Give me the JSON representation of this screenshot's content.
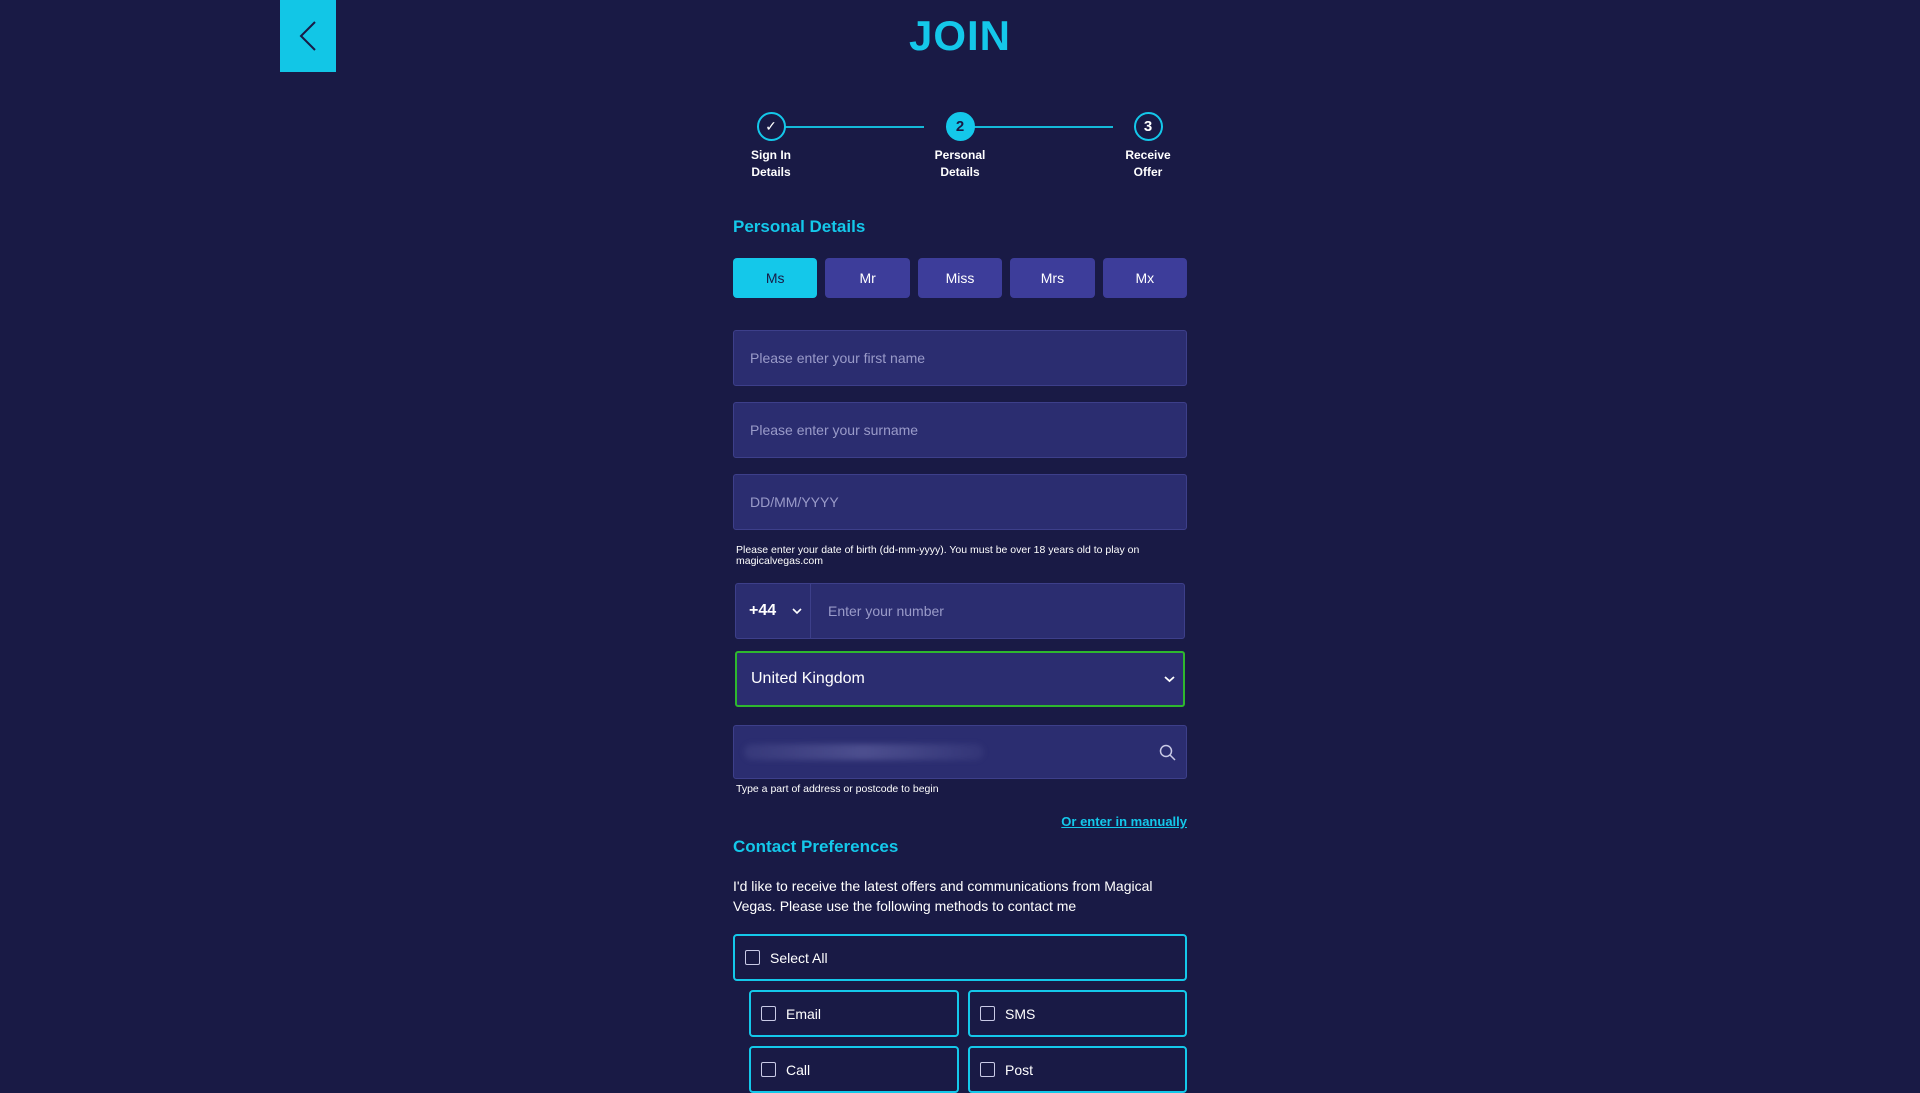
{
  "header": {
    "title": "JOIN",
    "back_icon": "chevron-left-icon"
  },
  "stepper": {
    "steps": [
      {
        "label_line1": "Sign In",
        "label_line2": "Details",
        "marker": "✓",
        "state": "completed"
      },
      {
        "label_line1": "Personal",
        "label_line2": "Details",
        "marker": "2",
        "state": "active"
      },
      {
        "label_line1": "Receive",
        "label_line2": "Offer",
        "marker": "3",
        "state": "upcoming"
      }
    ]
  },
  "personal": {
    "heading": "Personal Details",
    "titles": [
      "Ms",
      "Mr",
      "Miss",
      "Mrs",
      "Mx"
    ],
    "selected_title": "Ms",
    "first_name_placeholder": "Please enter your first name",
    "surname_placeholder": "Please enter your surname",
    "dob_placeholder": "DD/MM/YYYY",
    "dob_hint": "Please enter your date of birth (dd-mm-yyyy). You must be over 18 years old to play on magicalvegas.com",
    "phone_code": "+44",
    "phone_placeholder": "Enter your number",
    "country": "United Kingdom",
    "address_hint": "Type a part of address or postcode to begin",
    "manual_link": "Or enter in manually"
  },
  "contact": {
    "heading": "Contact Preferences",
    "text": "I'd like to receive the latest offers and communications from Magical Vegas. Please use the following methods to contact me",
    "select_all": "Select All",
    "options": [
      "Email",
      "SMS",
      "Call",
      "Post"
    ]
  },
  "colors": {
    "background": "#191a45",
    "accent": "#14c8ea",
    "field": "#2b2d70",
    "button": "#3d3d9a",
    "valid_border": "#2eb82e"
  }
}
